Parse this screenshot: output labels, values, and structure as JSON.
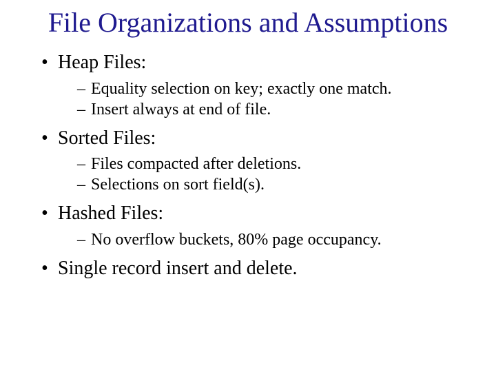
{
  "title": "File Organizations and Assumptions",
  "bullets": [
    {
      "label": "Heap Files:",
      "subs": [
        "Equality selection on key; exactly one match.",
        "Insert always at end of file."
      ]
    },
    {
      "label": "Sorted Files:",
      "subs": [
        "Files compacted after deletions.",
        "Selections on sort field(s)."
      ]
    },
    {
      "label": "Hashed Files:",
      "subs": [
        "No overflow buckets, 80% page occupancy."
      ]
    },
    {
      "label": "Single record insert and delete.",
      "subs": []
    }
  ]
}
